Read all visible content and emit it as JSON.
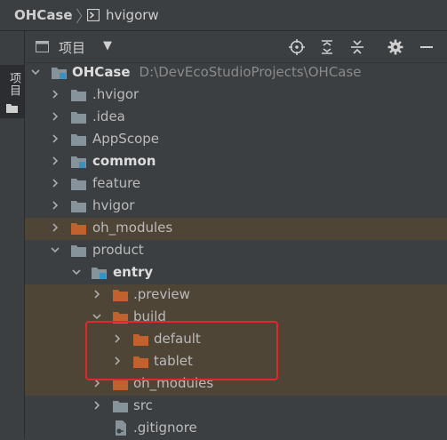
{
  "breadcrumb": {
    "project": "OHCase",
    "separator": "〉",
    "file": "hvigorw"
  },
  "side_strip": {
    "tab_label": "项目"
  },
  "panel": {
    "title": "项目",
    "dropdown_glyph": "▼"
  },
  "colors": {
    "background": "#3c3f41",
    "highlight_row": "#4e4537",
    "folder_gray": "#87939a",
    "folder_orange": "#c1622e",
    "module_marker": "#3592c4",
    "annotation_box": "#e0282e"
  },
  "tree": [
    {
      "label": "OHCase",
      "path": "D:\\DevEcoStudioProjects\\OHCase",
      "icon": "module-folder-icon",
      "expanded": true,
      "bold": true
    },
    {
      "label": ".hvigor",
      "icon": "folder-icon",
      "expanded": false
    },
    {
      "label": ".idea",
      "icon": "folder-icon",
      "expanded": false
    },
    {
      "label": "AppScope",
      "icon": "folder-icon",
      "expanded": false
    },
    {
      "label": "common",
      "icon": "module-folder-icon",
      "expanded": false,
      "bold": true
    },
    {
      "label": "feature",
      "icon": "folder-icon",
      "expanded": false
    },
    {
      "label": "hvigor",
      "icon": "folder-icon",
      "expanded": false
    },
    {
      "label": "oh_modules",
      "icon": "excluded-folder-icon",
      "expanded": false,
      "highlighted": true
    },
    {
      "label": "product",
      "icon": "folder-icon",
      "expanded": true
    },
    {
      "label": "entry",
      "icon": "module-folder-icon",
      "expanded": true,
      "bold": true
    },
    {
      "label": ".preview",
      "icon": "excluded-folder-icon",
      "expanded": false,
      "highlighted": true
    },
    {
      "label": "build",
      "icon": "excluded-folder-icon",
      "expanded": true,
      "highlighted": true
    },
    {
      "label": "default",
      "icon": "excluded-folder-icon",
      "expanded": false,
      "highlighted": true
    },
    {
      "label": "tablet",
      "icon": "excluded-folder-icon",
      "expanded": false,
      "highlighted": true
    },
    {
      "label": "oh_modules",
      "icon": "excluded-folder-icon",
      "expanded": false,
      "highlighted": true
    },
    {
      "label": "src",
      "icon": "folder-icon",
      "expanded": false
    },
    {
      "label": ".gitignore",
      "icon": "gitignore-file-icon"
    }
  ]
}
